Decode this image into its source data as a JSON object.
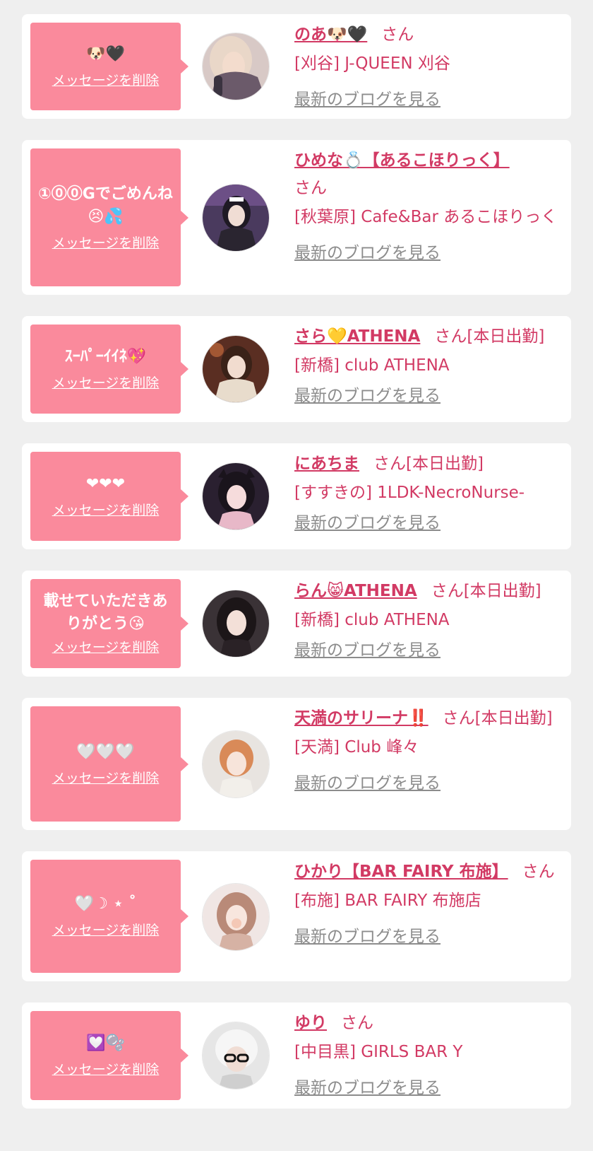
{
  "delete_label": "メッセージを削除",
  "blog_label": "最新のブログを見る",
  "cards": [
    {
      "message": "🐶🖤",
      "name": "のあ🐶🖤",
      "suffix": "さん",
      "shop": "[刈谷] J-QUEEN 刈谷"
    },
    {
      "message": "①⓪⓪Gでごめんね😣💦",
      "name": "ひめな💍【あるこほりっく】",
      "suffix": "さん",
      "shop": "[秋葉原] Cafe&Bar あるこほりっく"
    },
    {
      "message": "ｽｰﾊﾟｰｲｲﾈ💖",
      "name": "さら💛ATHENA",
      "suffix": "さん[本日出勤]",
      "shop": "[新橋] club ATHENA"
    },
    {
      "message": "❤❤❤",
      "name": "にあちま",
      "suffix": "さん[本日出勤]",
      "shop": "[すすきの] 1LDK-NecroNurse-"
    },
    {
      "message": "載せていただきありがとう😘",
      "name": "らん😸ATHENA",
      "suffix": "さん[本日出勤]",
      "shop": "[新橋] club ATHENA"
    },
    {
      "message": "🤍🤍🤍",
      "name": "天満のサリーナ‼️",
      "suffix": "さん[本日出勤]",
      "shop": "[天満] Club 峰々"
    },
    {
      "message": "🤍☽ ⋆ ˚",
      "name": "ひかり【BAR FAIRY 布施】",
      "suffix": "さん",
      "shop": "[布施] BAR FAIRY 布施店"
    },
    {
      "message": "💟🫧",
      "name": "ゆり",
      "suffix": "さん",
      "shop": "[中目黒] GIRLS BAR Y"
    }
  ]
}
